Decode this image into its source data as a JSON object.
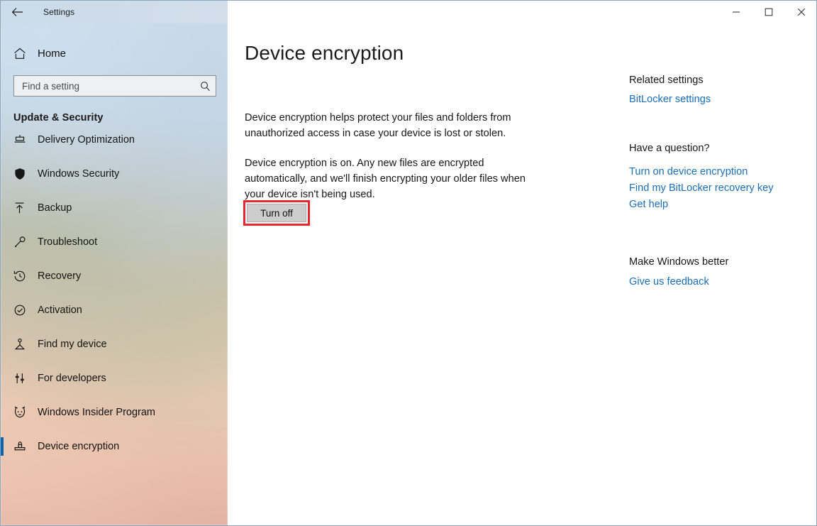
{
  "window": {
    "app_title": "Settings",
    "back_icon": "back-arrow-icon",
    "controls": {
      "minimize": "minimize-icon",
      "maximize": "maximize-icon",
      "close": "close-icon"
    }
  },
  "sidebar": {
    "home_label": "Home",
    "home_icon": "home-icon",
    "search": {
      "placeholder": "Find a setting",
      "value": "",
      "icon": "search-icon"
    },
    "group_header": "Update & Security",
    "items": [
      {
        "label": "Delivery Optimization",
        "icon": "delivery-optimization-icon",
        "selected": false
      },
      {
        "label": "Windows Security",
        "icon": "shield-icon",
        "selected": false
      },
      {
        "label": "Backup",
        "icon": "upload-arrow-icon",
        "selected": false
      },
      {
        "label": "Troubleshoot",
        "icon": "wrench-icon",
        "selected": false
      },
      {
        "label": "Recovery",
        "icon": "history-clock-icon",
        "selected": false
      },
      {
        "label": "Activation",
        "icon": "check-circle-icon",
        "selected": false
      },
      {
        "label": "Find my device",
        "icon": "person-location-icon",
        "selected": false
      },
      {
        "label": "For developers",
        "icon": "dev-tools-icon",
        "selected": false
      },
      {
        "label": "Windows Insider Program",
        "icon": "insider-mascot-icon",
        "selected": false
      },
      {
        "label": "Device encryption",
        "icon": "lock-icon",
        "selected": true
      }
    ]
  },
  "main": {
    "page_title": "Device encryption",
    "paragraph_1": "Device encryption helps protect your files and folders from unauthorized access in case your device is lost or stolen.",
    "paragraph_2": "Device encryption is on. Any new files are encrypted automatically, and we'll finish encrypting your older files when your device isn't being used.",
    "turn_off_button": "Turn off"
  },
  "rail": {
    "related_settings": {
      "heading": "Related settings",
      "links": [
        "BitLocker settings"
      ]
    },
    "have_a_question": {
      "heading": "Have a question?",
      "links": [
        "Turn on device encryption",
        "Find my BitLocker recovery key",
        "Get help"
      ]
    },
    "make_windows_better": {
      "heading": "Make Windows better",
      "links": [
        "Give us feedback"
      ]
    }
  },
  "colors": {
    "accent": "#0a64ad",
    "link": "#1a6fb4",
    "annotation": "#e8262d",
    "button_face": "#cdcdcd"
  }
}
